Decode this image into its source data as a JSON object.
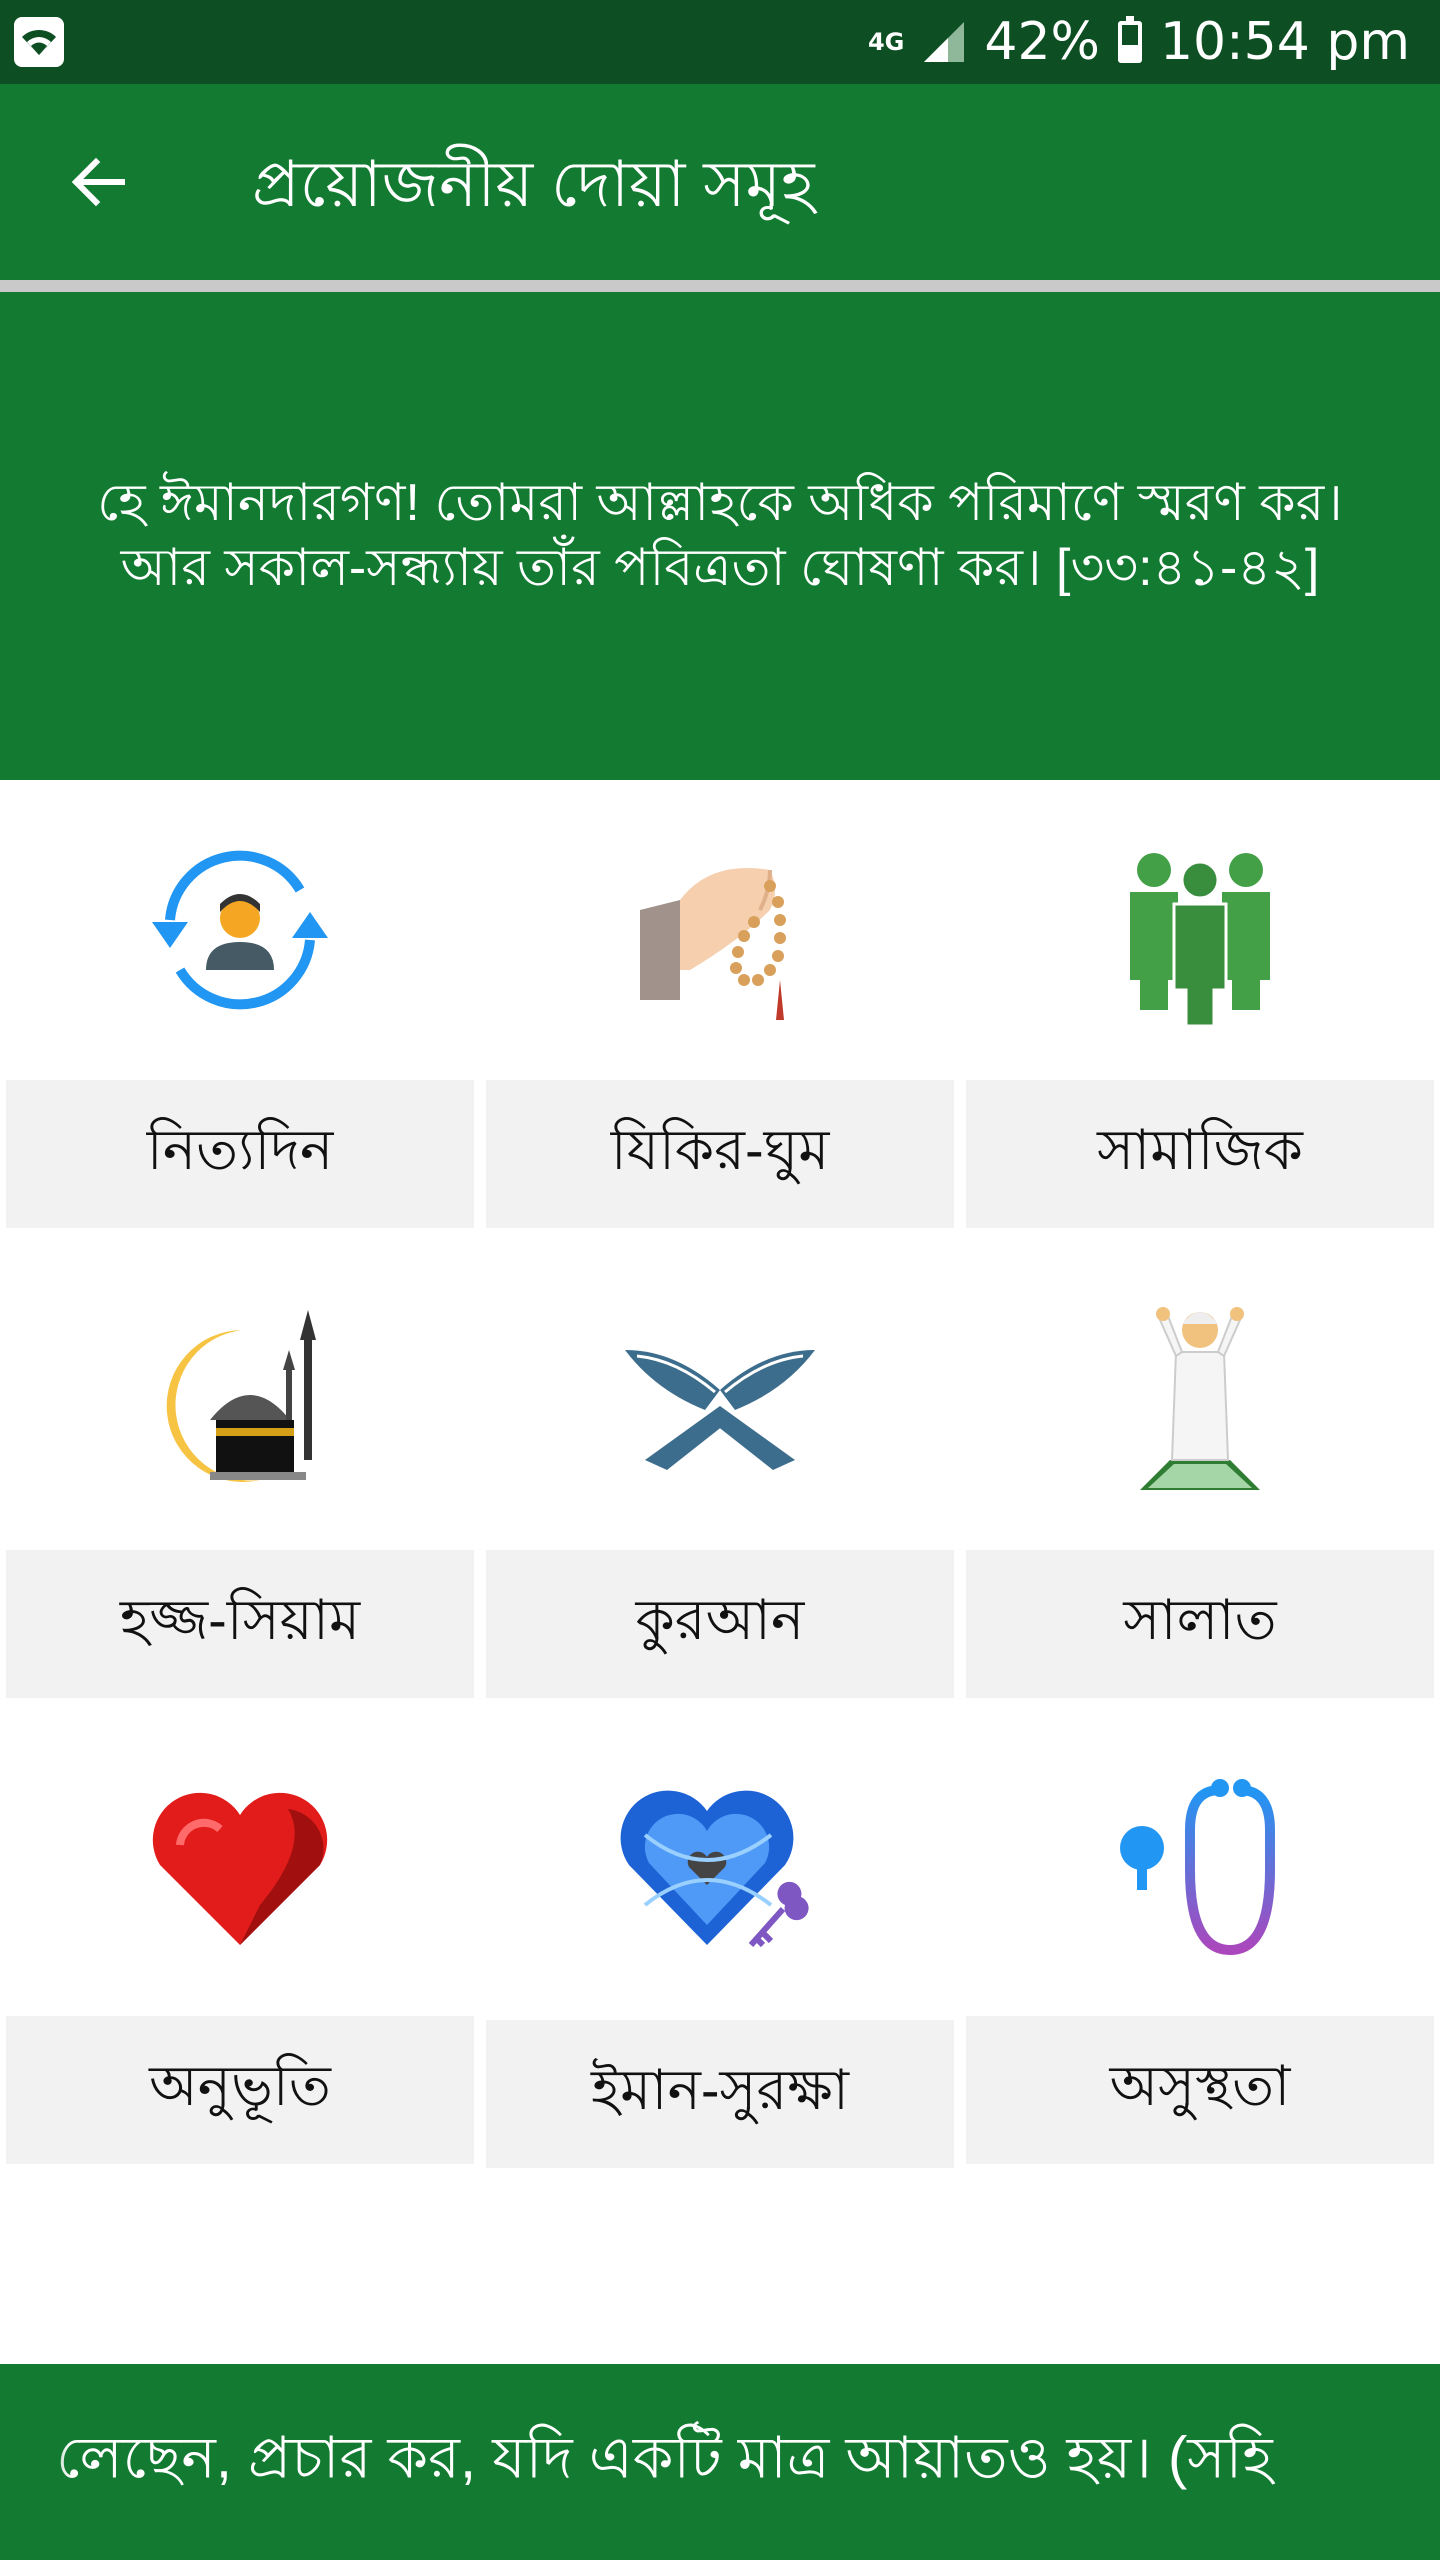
{
  "status_bar": {
    "network": "4G",
    "battery": "42%",
    "time": "10:54 pm"
  },
  "app_bar": {
    "title": "প্রয়োজনীয় দোয়া সমূহ"
  },
  "verse": {
    "text": "হে ঈমানদারগণ! তোমরা আল্লাহকে অধিক পরিমাণে স্মরণ কর। আর সকাল-সন্ধ্যায় তাঁর পবিত্রতা ঘোষণা কর। [৩৩:৪১-৪২]"
  },
  "categories": [
    {
      "label": "নিত্যদিন",
      "icon": "daily-routine-person-icon"
    },
    {
      "label": "যিকির-ঘুম",
      "icon": "prayer-beads-hand-icon"
    },
    {
      "label": "সামাজিক",
      "icon": "people-group-icon"
    },
    {
      "label": "হজ্জ-সিয়াম",
      "icon": "kaaba-crescent-icon"
    },
    {
      "label": "কুরআন",
      "icon": "quran-open-book-icon"
    },
    {
      "label": "সালাত",
      "icon": "praying-boy-icon"
    },
    {
      "label": "অনুভূতি",
      "icon": "red-heart-icon"
    },
    {
      "label": "ইমান-সুরক্ষা",
      "icon": "locked-heart-key-icon"
    },
    {
      "label": "অসুস্থতা",
      "icon": "stethoscope-icon"
    }
  ],
  "ticker": {
    "text": "লেছেন, প্রচার কর, যদি একটি মাত্র আয়াতও হয়। (সহি"
  },
  "colors": {
    "primary": "#137a32",
    "status_bar": "#0d4f22",
    "tile_background": "#f2f2f2"
  }
}
